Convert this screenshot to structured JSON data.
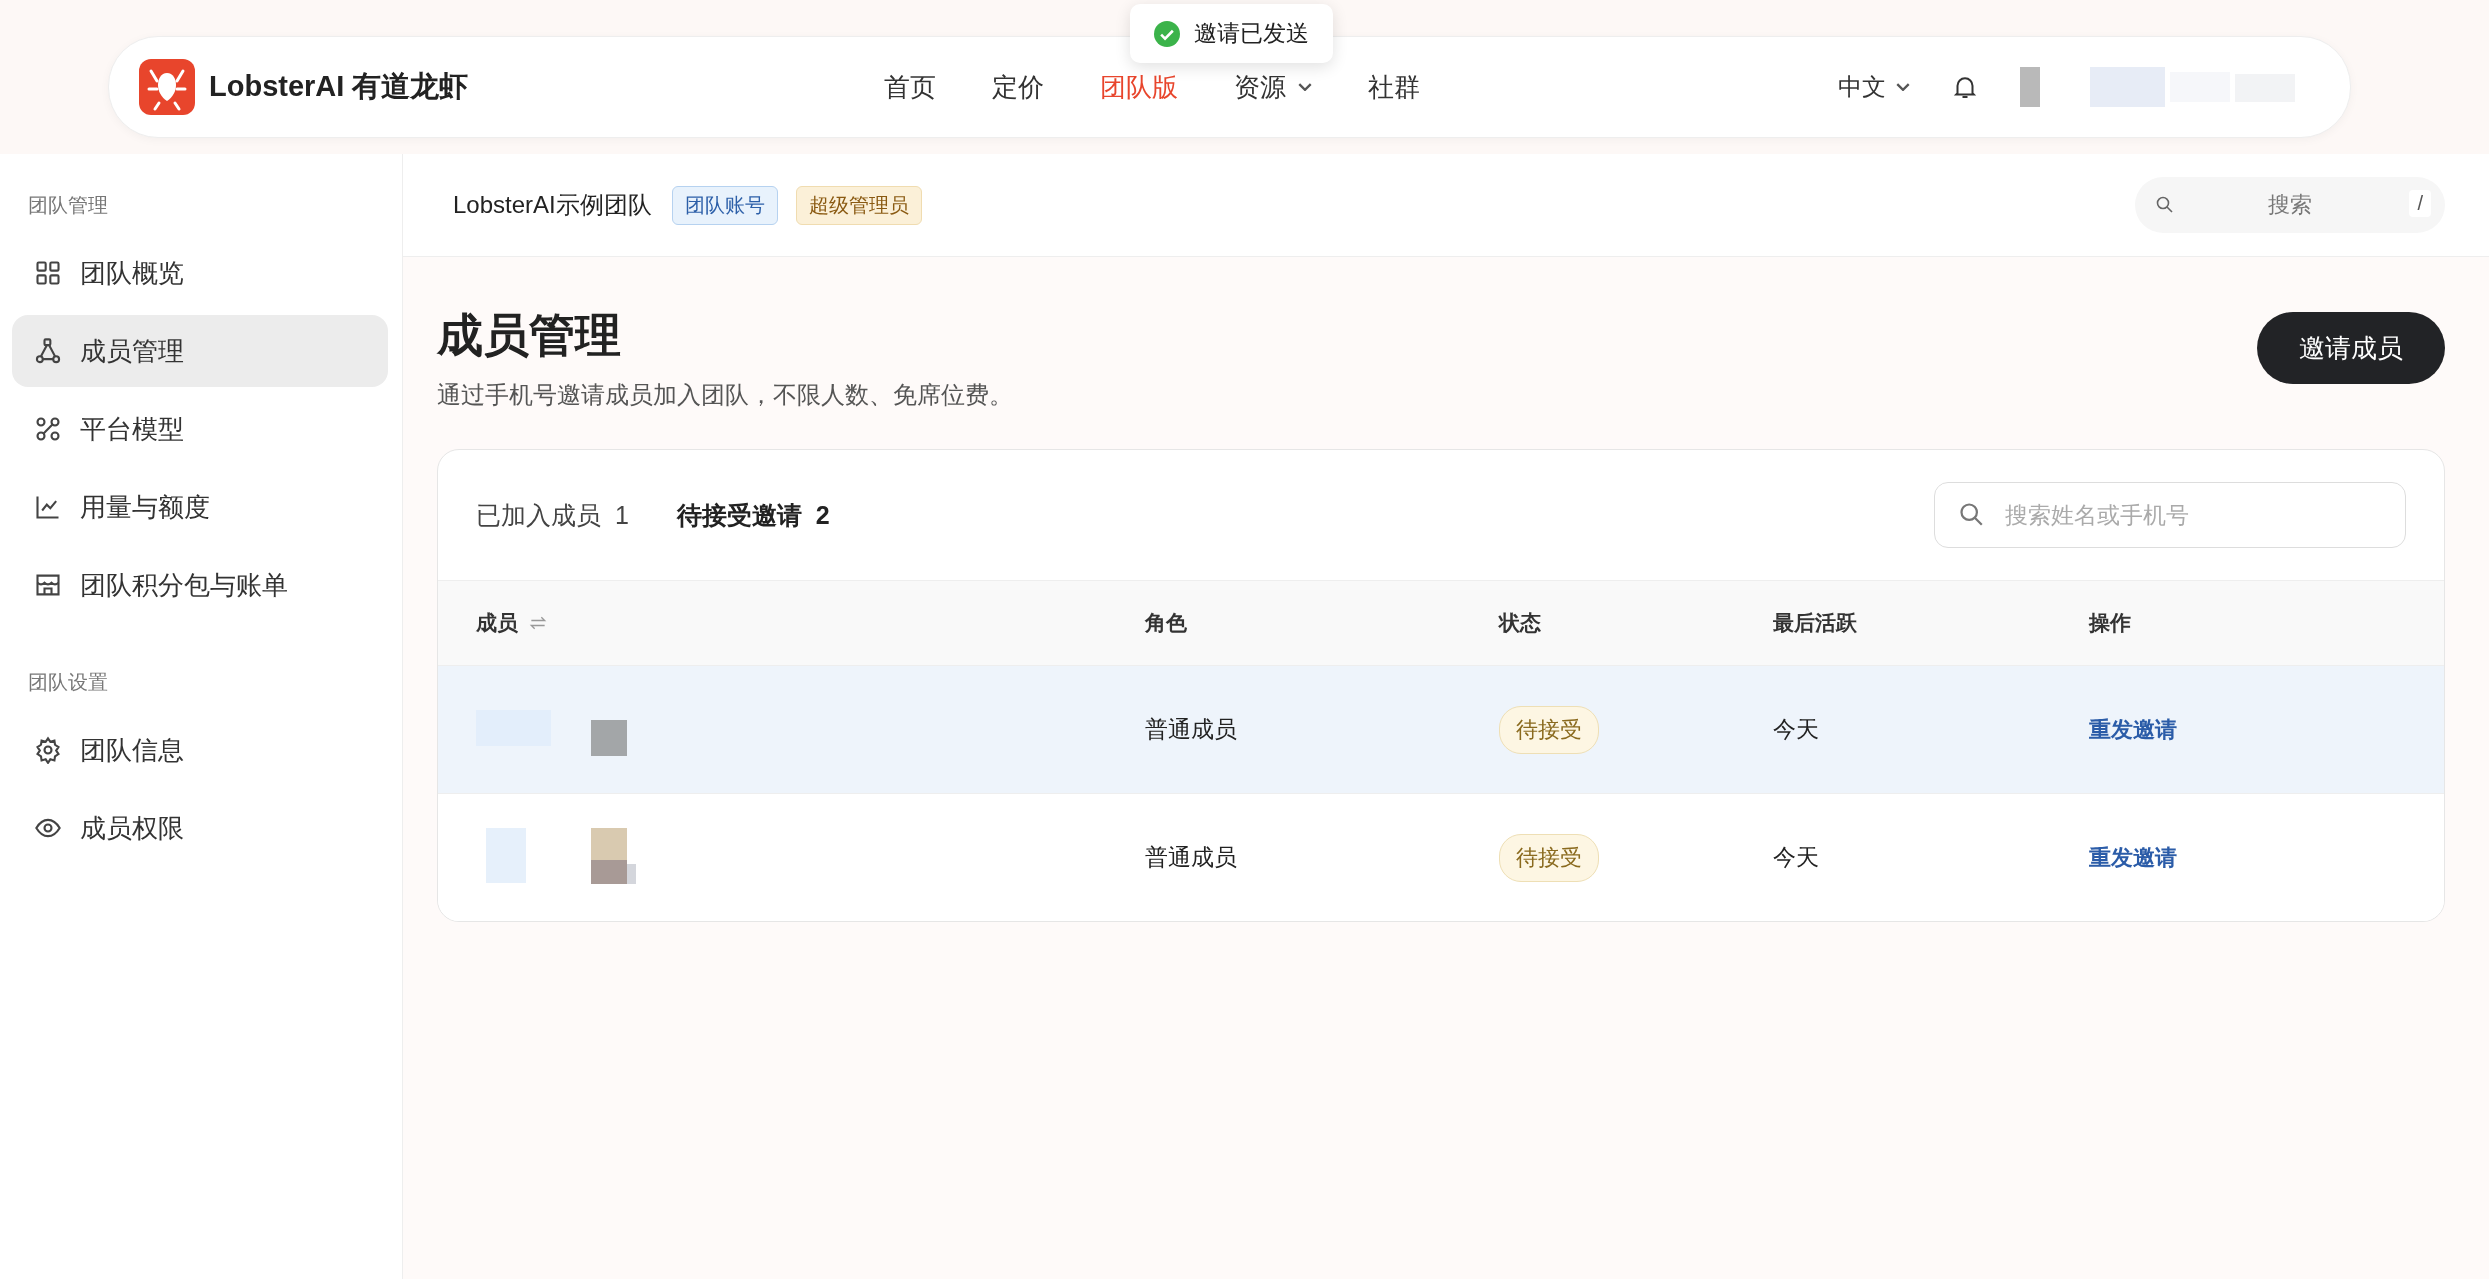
{
  "brand": {
    "name": "LobsterAI 有道龙虾"
  },
  "nav": [
    {
      "label": "首页",
      "selected": false,
      "caret": false
    },
    {
      "label": "定价",
      "selected": false,
      "caret": false
    },
    {
      "label": "团队版",
      "selected": true,
      "caret": false
    },
    {
      "label": "资源",
      "selected": false,
      "caret": true
    },
    {
      "label": "社群",
      "selected": false,
      "caret": false
    }
  ],
  "language": "中文",
  "toast": {
    "text": "邀请已发送"
  },
  "sidebar": {
    "sections": [
      {
        "title": "团队管理",
        "items": [
          {
            "label": "团队概览",
            "selected": false
          },
          {
            "label": "成员管理",
            "selected": true
          },
          {
            "label": "平台模型",
            "selected": false
          },
          {
            "label": "用量与额度",
            "selected": false
          },
          {
            "label": "团队积分包与账单",
            "selected": false
          }
        ]
      },
      {
        "title": "团队设置",
        "items": [
          {
            "label": "团队信息",
            "selected": false
          },
          {
            "label": "成员权限",
            "selected": false
          }
        ]
      }
    ]
  },
  "topbar": {
    "team": "LobsterAI示例团队",
    "badges": [
      {
        "text": "团队账号",
        "kind": "blue"
      },
      {
        "text": "超级管理员",
        "kind": "gold"
      }
    ],
    "search": {
      "placeholder": "搜索",
      "shortcut": "/"
    }
  },
  "page": {
    "title": "成员管理",
    "subtitle": "通过手机号邀请成员加入团队，不限人数、免席位费。",
    "invite_button": "邀请成员"
  },
  "tabs": [
    {
      "label": "已加入成员",
      "count": "1",
      "selected": false
    },
    {
      "label": "待接受邀请",
      "count": "2",
      "selected": true
    }
  ],
  "member_search": {
    "placeholder": "搜索姓名或手机号"
  },
  "table": {
    "columns": [
      {
        "label": "成员",
        "sortable": true
      },
      {
        "label": "角色",
        "sortable": false
      },
      {
        "label": "状态",
        "sortable": false
      },
      {
        "label": "最后活跃",
        "sortable": false
      },
      {
        "label": "操作",
        "sortable": false
      }
    ],
    "rows": [
      {
        "role": "普通成员",
        "status": "待接受",
        "last_active": "今天",
        "action": "重发邀请",
        "highlighted": true
      },
      {
        "role": "普通成员",
        "status": "待接受",
        "last_active": "今天",
        "action": "重发邀请",
        "highlighted": false
      }
    ]
  }
}
